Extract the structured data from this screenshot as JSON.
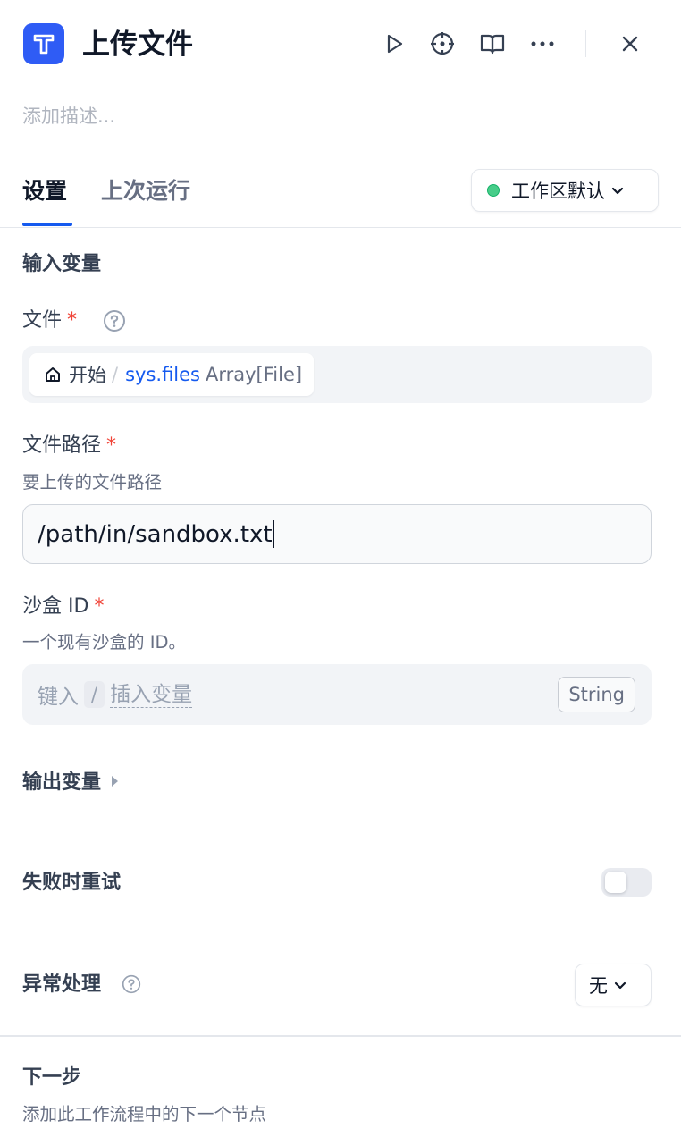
{
  "header": {
    "title": "上传文件",
    "description_placeholder": "添加描述...",
    "actions": [
      "run-icon",
      "locate-icon",
      "docs-icon",
      "more-icon",
      "close-icon"
    ]
  },
  "tabs": [
    {
      "label": "设置",
      "active": true
    },
    {
      "label": "上次运行",
      "active": false
    }
  ],
  "workspace_select": {
    "label": "工作区默认",
    "status_color": "#47cd89"
  },
  "input_section": {
    "title": "输入变量"
  },
  "file_field": {
    "label": "文件",
    "required_mark": "*",
    "node_name": "开始",
    "separator": "/",
    "variable": "sys.files",
    "variable_type": "Array[File]"
  },
  "path_field": {
    "label": "文件路径",
    "required_mark": "*",
    "hint": "要上传的文件路径",
    "value": "/path/in/sandbox.txt"
  },
  "sandbox_field": {
    "label": "沙盒 ID",
    "required_mark": "*",
    "hint": "一个现有沙盒的 ID。",
    "placeholder_prefix": "键入",
    "placeholder_key": "/",
    "placeholder_suffix": "插入变量",
    "type_badge": "String"
  },
  "output_section": {
    "title": "输出变量",
    "expanded": false
  },
  "retry": {
    "label": "失败时重试",
    "enabled": false
  },
  "error_handling": {
    "label": "异常处理",
    "value": "无"
  },
  "next_step": {
    "title": "下一步",
    "description": "添加此工作流程中的下一个节点"
  },
  "colors": {
    "accent": "#155aef",
    "logo": "#2f5cf5",
    "required": "#f04438"
  }
}
